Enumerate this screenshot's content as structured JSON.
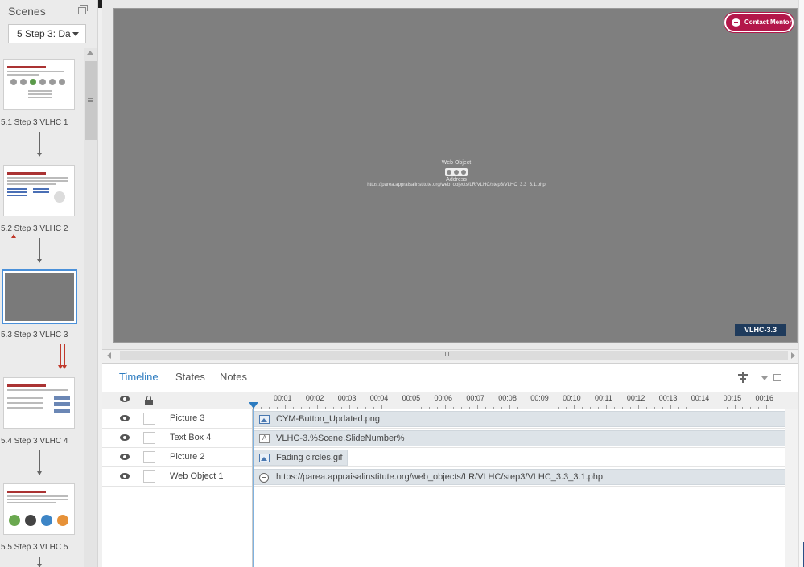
{
  "scenes_panel": {
    "title": "Scenes",
    "selected_scene": "5 Step 3: Da",
    "scenes": [
      {
        "label": "5.1 Step 3 VLHC 1"
      },
      {
        "label": "5.2 Step 3 VLHC 2"
      },
      {
        "label": "5.3 Step 3 VLHC 3"
      },
      {
        "label": "5.4 Step 3 VLHC 4"
      },
      {
        "label": "5.5 Step 3 VLHC 5"
      }
    ]
  },
  "stage": {
    "contact_button_label": "Contact Mentor",
    "web_object_title": "Web Object",
    "web_object_address_label": "Address",
    "web_object_url": "https://parea.appraisalinstitute.org/web_objects/LR/VLHC/step3/VLHC_3.3_3.1.php",
    "slide_number_text": "VLHC-3.3"
  },
  "timeline": {
    "tabs": [
      "Timeline",
      "States",
      "Notes"
    ],
    "active_tab": "Timeline",
    "ruler_ticks": [
      "00:01",
      "00:02",
      "00:03",
      "00:04",
      "00:05",
      "00:06",
      "00:07",
      "00:08",
      "00:09",
      "00:10",
      "00:11",
      "00:12",
      "00:13",
      "00:14",
      "00:15",
      "00:16"
    ],
    "rows": [
      {
        "name": "Picture 3",
        "item_label": "CYM-Button_Updated.png",
        "icon": "image-icon"
      },
      {
        "name": "Text Box 4",
        "item_label": "VLHC-3.%Scene.SlideNumber%",
        "icon": "textbox-icon"
      },
      {
        "name": "Picture 2",
        "item_label": "Fading circles.gif",
        "icon": "image-icon"
      },
      {
        "name": "Web Object 1",
        "item_label": "https://parea.appraisalinstitute.org/web_objects/LR/VLHC/step3/VLHC_3.3_3.1.php",
        "icon": "web-object-icon"
      }
    ]
  },
  "colors": {
    "accent_blue": "#2b7bc0",
    "contact_button": "#b3174a",
    "slide_number_bg": "#1f3b5c",
    "stage_bg": "#7f7f7f",
    "red_arrow": "#c0392b"
  }
}
